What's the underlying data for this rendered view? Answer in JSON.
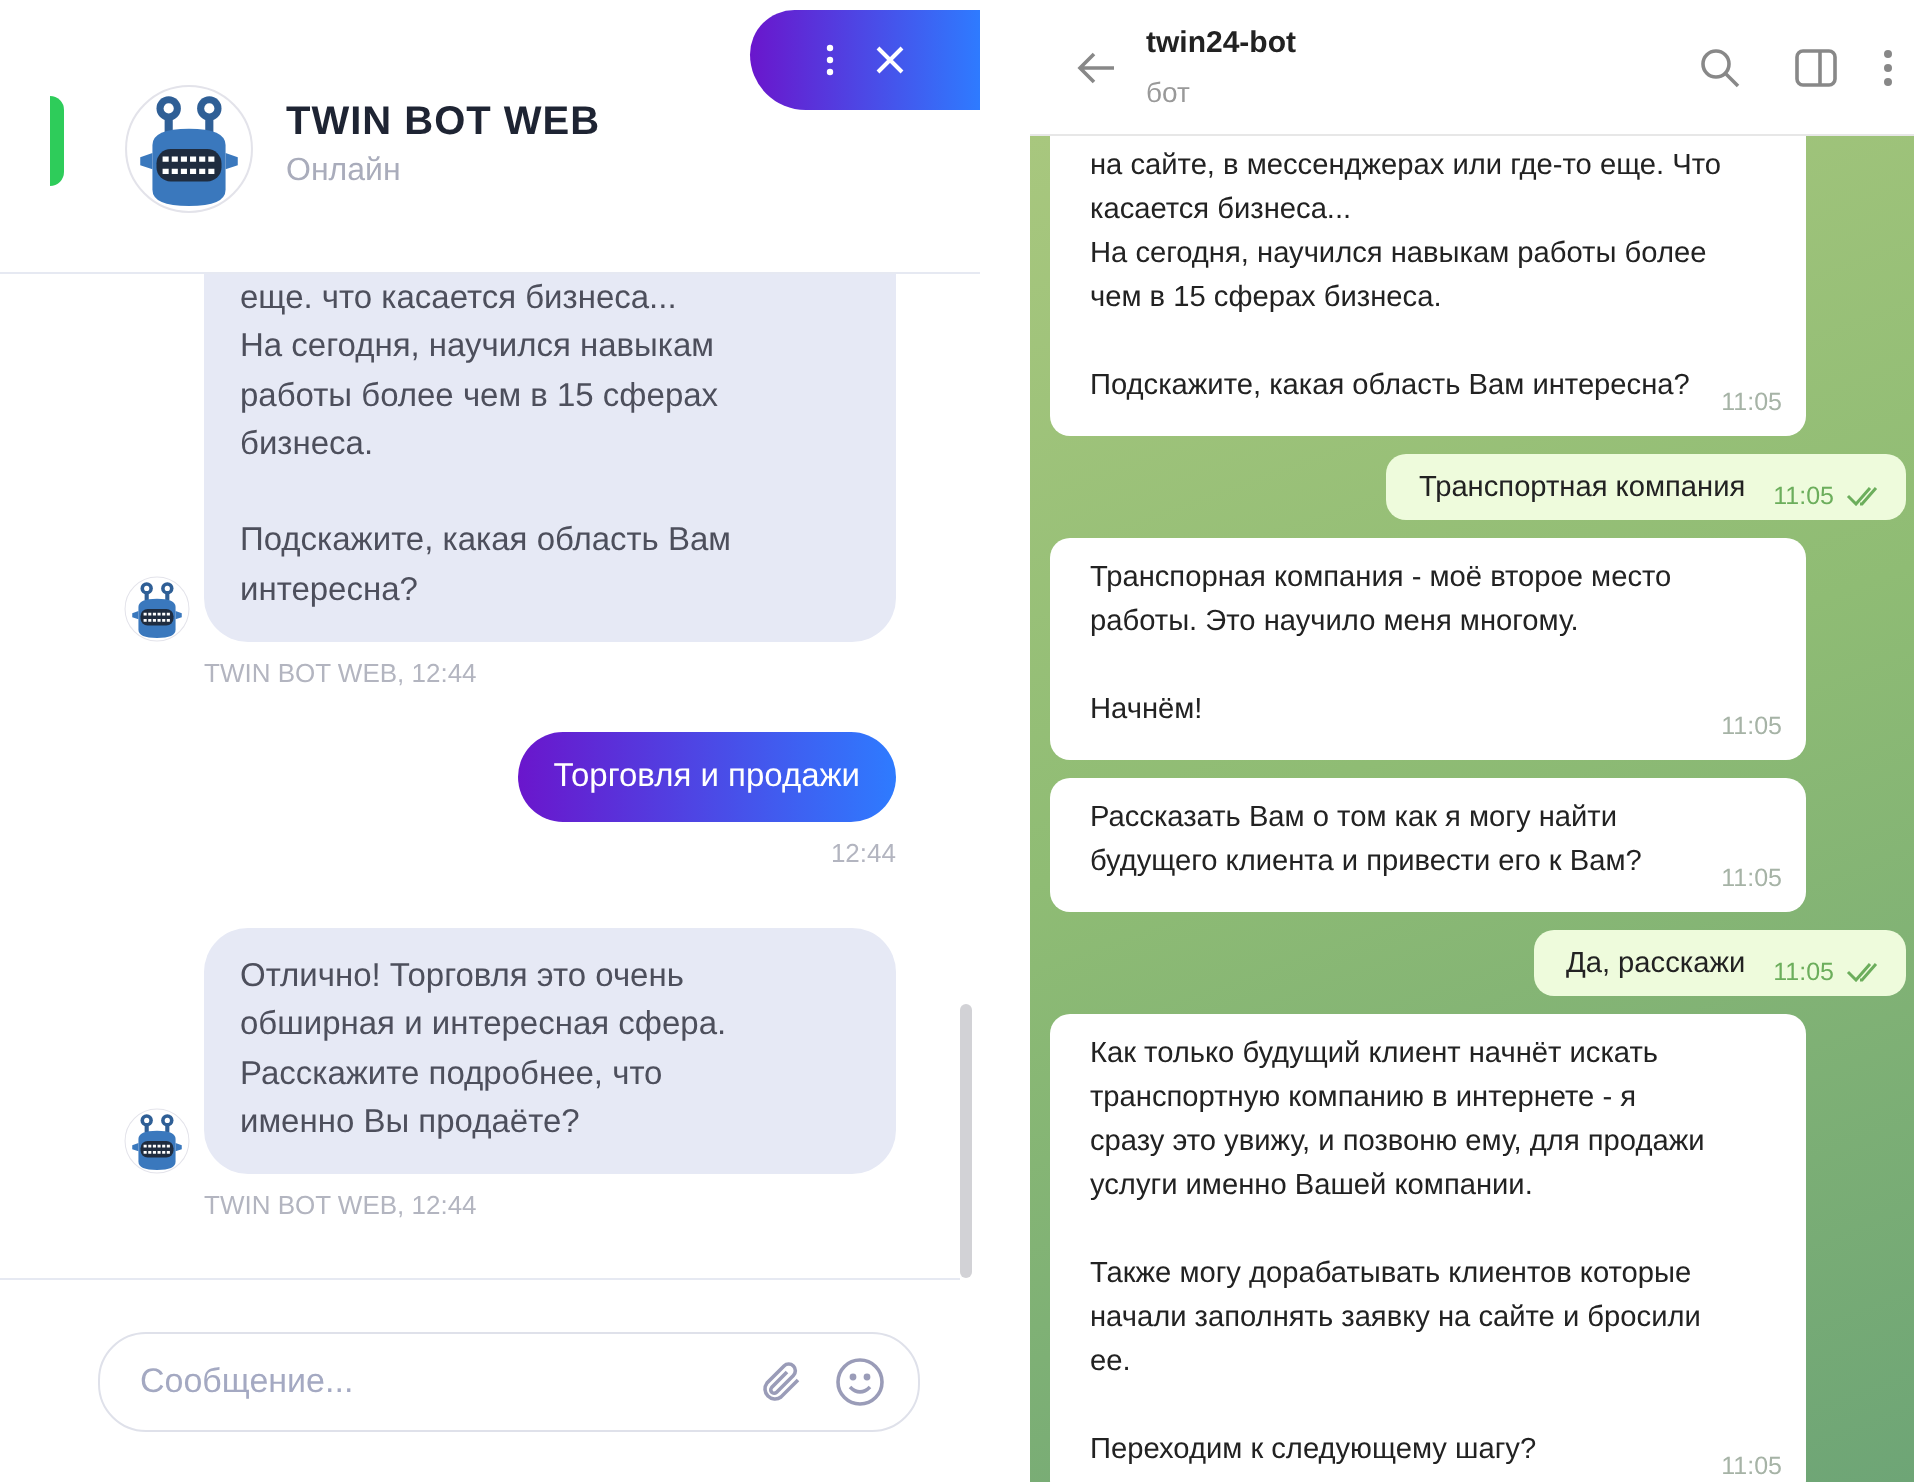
{
  "widget": {
    "title": "TWIN BOT WEB",
    "status": "Онлайн",
    "messages": [
      {
        "kind": "bot",
        "text": "еще. что касается бизнеса...\nНа сегодня, научился навыкам\nработы более чем в 15 сферах\nбизнеса.\n\nПодскажите, какая область Вам\nинтересна?",
        "meta": "TWIN BOT WEB, 12:44"
      },
      {
        "kind": "user",
        "text": "Торговля и продажи",
        "meta": "12:44"
      },
      {
        "kind": "bot",
        "text": "Отлично! Торговля это очень\nобширная и интересная сфера.\nРасскажите подробнее, что\nименно Вы продаёте?",
        "meta": "TWIN BOT WEB, 12:44"
      }
    ],
    "input": {
      "placeholder": "Сообщение..."
    }
  },
  "telegram": {
    "title": "twin24-bot",
    "subtitle": "бот",
    "messages": [
      {
        "kind": "in",
        "text": "на сайте, в мессенджерах или где-то еще. Что\nкасается бизнеса...\nНа сегодня, научился навыкам работы более\nчем в 15 сферах бизнеса.\n\nПодскажите, какая область Вам интересна?",
        "time": "11:05"
      },
      {
        "kind": "out",
        "text": "Транспортная компания",
        "time": "11:05",
        "read": true
      },
      {
        "kind": "in",
        "text": "Транспорная компания - моё второе место\nработы. Это научило меня многому.\n\nНачнём!",
        "time": "11:05"
      },
      {
        "kind": "in",
        "text": "Рассказать Вам о том как я могу найти\nбудущего клиента и привести его к Вам?",
        "time": "11:05"
      },
      {
        "kind": "out",
        "text": "Да, расскажи",
        "time": "11:05",
        "read": true
      },
      {
        "kind": "in",
        "text": "Как только будущий клиент начнёт искать\nтранспортную компанию в интернете - я\nсразу это увижу, и позвоню ему, для продажи\nуслуги именно Вашей компании.\n\nТакже могу дорабатывать клиентов которые\nначали заполнять заявку на сайте и бросили\nее.\n\nПереходим к следующему шагу?",
        "time": "11:05"
      }
    ]
  }
}
